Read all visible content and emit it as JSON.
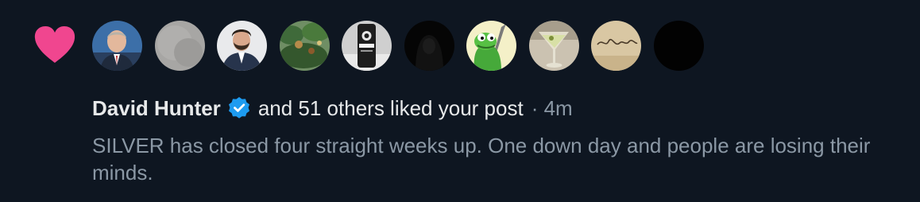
{
  "notification": {
    "author_name": "David Hunter",
    "action_text": "and 51 others liked your post",
    "separator": "·",
    "time_ago": "4m",
    "post_text": "SILVER has closed four straight weeks up. One down day and people are losing their minds."
  },
  "icons": {
    "like": "heart-icon",
    "verified": "verified-badge-icon"
  },
  "colors": {
    "background": "#0e1621",
    "heart": "#f0468f",
    "verified": "#1d9bf0",
    "primary_text": "#e7e9ea",
    "secondary_text": "#8b98a5"
  }
}
